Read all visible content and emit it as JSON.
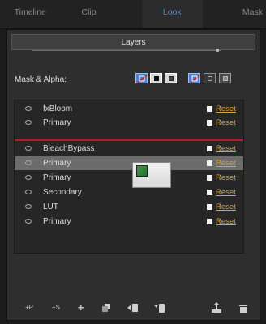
{
  "tabs": [
    {
      "label": "Timeline",
      "active": false
    },
    {
      "label": "Clip",
      "active": false
    },
    {
      "label": "Look",
      "active": true
    },
    {
      "label": "Mask",
      "active": false
    }
  ],
  "panel": {
    "title": "Layers"
  },
  "mask_alpha": {
    "label": "Mask & Alpha:"
  },
  "layers": [
    {
      "name": "fxBloom",
      "reset": "Reset",
      "selected": false
    },
    {
      "name": "Primary",
      "reset": "Reset",
      "selected": false
    },
    {
      "name": "BleachBypass",
      "reset": "Reset",
      "selected": false
    },
    {
      "name": "Primary",
      "reset": "Reset",
      "selected": true
    },
    {
      "name": "Primary",
      "reset": "Reset",
      "selected": false
    },
    {
      "name": "Secondary",
      "reset": "Reset",
      "selected": false
    },
    {
      "name": "LUT",
      "reset": "Reset",
      "selected": false
    },
    {
      "name": "Primary",
      "reset": "Reset",
      "selected": false
    }
  ],
  "toolbar": {
    "add_primary": "+P",
    "add_secondary": "+S",
    "add": "+"
  },
  "colors": {
    "active_tab": "#4d8fd6",
    "reset_link": "#d8a632",
    "drop_indicator": "#b81d1d",
    "selected_row": "#6b6b6b"
  }
}
